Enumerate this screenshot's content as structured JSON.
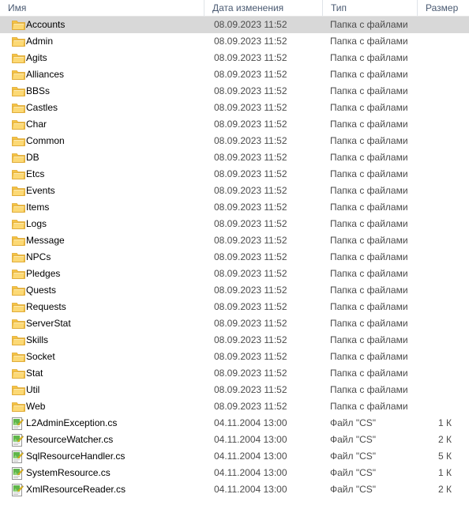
{
  "columns": {
    "name": "Имя",
    "date_modified": "Дата изменения",
    "type": "Тип",
    "size": "Размер"
  },
  "icons": {
    "folder": "folder-icon",
    "cs_file": "cs-file-icon"
  },
  "colors": {
    "selection": "#d8d8d8",
    "folder_body": "#fcd975",
    "folder_tab": "#f5c344",
    "folder_edge": "#dfa82e",
    "header_text": "#4a5a72",
    "row_text": "#000000",
    "secondary_text": "#4b4b4b",
    "grid_line": "#dfe3e8",
    "file_green": "#5fb54a",
    "file_paper": "#ffffff",
    "file_pencil": "#f0c419"
  },
  "types": {
    "folder": "Папка с файлами",
    "cs_file": "Файл \"CS\""
  },
  "rows": [
    {
      "name": "Accounts",
      "date": "08.09.2023 11:52",
      "type": "Папка с файлами",
      "size": "",
      "icon": "folder-icon",
      "selected": true
    },
    {
      "name": "Admin",
      "date": "08.09.2023 11:52",
      "type": "Папка с файлами",
      "size": "",
      "icon": "folder-icon",
      "selected": false
    },
    {
      "name": "Agits",
      "date": "08.09.2023 11:52",
      "type": "Папка с файлами",
      "size": "",
      "icon": "folder-icon",
      "selected": false
    },
    {
      "name": "Alliances",
      "date": "08.09.2023 11:52",
      "type": "Папка с файлами",
      "size": "",
      "icon": "folder-icon",
      "selected": false
    },
    {
      "name": "BBSs",
      "date": "08.09.2023 11:52",
      "type": "Папка с файлами",
      "size": "",
      "icon": "folder-icon",
      "selected": false
    },
    {
      "name": "Castles",
      "date": "08.09.2023 11:52",
      "type": "Папка с файлами",
      "size": "",
      "icon": "folder-icon",
      "selected": false
    },
    {
      "name": "Char",
      "date": "08.09.2023 11:52",
      "type": "Папка с файлами",
      "size": "",
      "icon": "folder-icon",
      "selected": false
    },
    {
      "name": "Common",
      "date": "08.09.2023 11:52",
      "type": "Папка с файлами",
      "size": "",
      "icon": "folder-icon",
      "selected": false
    },
    {
      "name": "DB",
      "date": "08.09.2023 11:52",
      "type": "Папка с файлами",
      "size": "",
      "icon": "folder-icon",
      "selected": false
    },
    {
      "name": "Etcs",
      "date": "08.09.2023 11:52",
      "type": "Папка с файлами",
      "size": "",
      "icon": "folder-icon",
      "selected": false
    },
    {
      "name": "Events",
      "date": "08.09.2023 11:52",
      "type": "Папка с файлами",
      "size": "",
      "icon": "folder-icon",
      "selected": false
    },
    {
      "name": "Items",
      "date": "08.09.2023 11:52",
      "type": "Папка с файлами",
      "size": "",
      "icon": "folder-icon",
      "selected": false
    },
    {
      "name": "Logs",
      "date": "08.09.2023 11:52",
      "type": "Папка с файлами",
      "size": "",
      "icon": "folder-icon",
      "selected": false
    },
    {
      "name": "Message",
      "date": "08.09.2023 11:52",
      "type": "Папка с файлами",
      "size": "",
      "icon": "folder-icon",
      "selected": false
    },
    {
      "name": "NPCs",
      "date": "08.09.2023 11:52",
      "type": "Папка с файлами",
      "size": "",
      "icon": "folder-icon",
      "selected": false
    },
    {
      "name": "Pledges",
      "date": "08.09.2023 11:52",
      "type": "Папка с файлами",
      "size": "",
      "icon": "folder-icon",
      "selected": false
    },
    {
      "name": "Quests",
      "date": "08.09.2023 11:52",
      "type": "Папка с файлами",
      "size": "",
      "icon": "folder-icon",
      "selected": false
    },
    {
      "name": "Requests",
      "date": "08.09.2023 11:52",
      "type": "Папка с файлами",
      "size": "",
      "icon": "folder-icon",
      "selected": false
    },
    {
      "name": "ServerStat",
      "date": "08.09.2023 11:52",
      "type": "Папка с файлами",
      "size": "",
      "icon": "folder-icon",
      "selected": false
    },
    {
      "name": "Skills",
      "date": "08.09.2023 11:52",
      "type": "Папка с файлами",
      "size": "",
      "icon": "folder-icon",
      "selected": false
    },
    {
      "name": "Socket",
      "date": "08.09.2023 11:52",
      "type": "Папка с файлами",
      "size": "",
      "icon": "folder-icon",
      "selected": false
    },
    {
      "name": "Stat",
      "date": "08.09.2023 11:52",
      "type": "Папка с файлами",
      "size": "",
      "icon": "folder-icon",
      "selected": false
    },
    {
      "name": "Util",
      "date": "08.09.2023 11:52",
      "type": "Папка с файлами",
      "size": "",
      "icon": "folder-icon",
      "selected": false
    },
    {
      "name": "Web",
      "date": "08.09.2023 11:52",
      "type": "Папка с файлами",
      "size": "",
      "icon": "folder-icon",
      "selected": false
    },
    {
      "name": "L2AdminException.cs",
      "date": "04.11.2004 13:00",
      "type": "Файл \"CS\"",
      "size": "1 К",
      "icon": "cs-file-icon",
      "selected": false
    },
    {
      "name": "ResourceWatcher.cs",
      "date": "04.11.2004 13:00",
      "type": "Файл \"CS\"",
      "size": "2 К",
      "icon": "cs-file-icon",
      "selected": false
    },
    {
      "name": "SqlResourceHandler.cs",
      "date": "04.11.2004 13:00",
      "type": "Файл \"CS\"",
      "size": "5 К",
      "icon": "cs-file-icon",
      "selected": false
    },
    {
      "name": "SystemResource.cs",
      "date": "04.11.2004 13:00",
      "type": "Файл \"CS\"",
      "size": "1 К",
      "icon": "cs-file-icon",
      "selected": false
    },
    {
      "name": "XmlResourceReader.cs",
      "date": "04.11.2004 13:00",
      "type": "Файл \"CS\"",
      "size": "2 К",
      "icon": "cs-file-icon",
      "selected": false
    }
  ]
}
